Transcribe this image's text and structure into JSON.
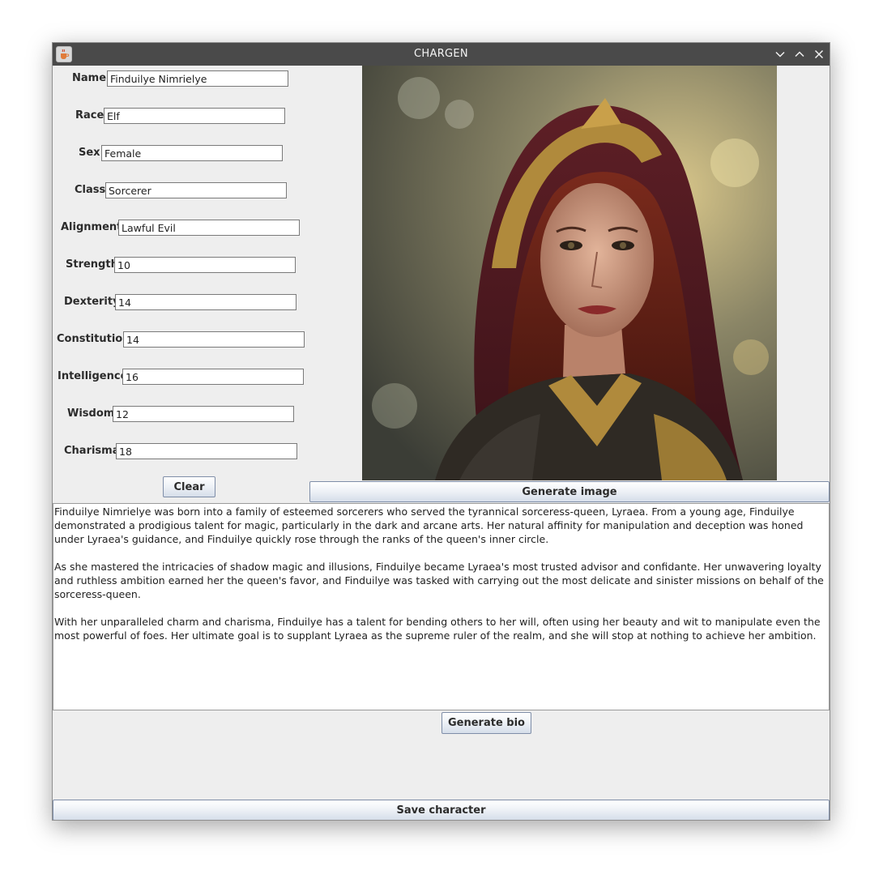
{
  "window": {
    "title": "CHARGEN"
  },
  "icons": {
    "app": "java-cup-icon",
    "minimize": "chevron-down-icon",
    "maximize": "chevron-up-icon",
    "close": "close-icon"
  },
  "fields": {
    "name": {
      "label": "Name:",
      "value": "Finduilye Nimrielye"
    },
    "race": {
      "label": "Race:",
      "value": "Elf"
    },
    "sex": {
      "label": "Sex:",
      "value": "Female"
    },
    "class": {
      "label": "Class:",
      "value": "Sorcerer"
    },
    "alignment": {
      "label": "Alignment:",
      "value": "Lawful Evil"
    },
    "strength": {
      "label": "Strength:",
      "value": "10"
    },
    "dexterity": {
      "label": "Dexterity:",
      "value": "14"
    },
    "constitution": {
      "label": "Constitution:",
      "value": "14"
    },
    "intelligence": {
      "label": "Intelligence:",
      "value": "16"
    },
    "wisdom": {
      "label": "Wisdom:",
      "value": "12"
    },
    "charisma": {
      "label": "Charisma:",
      "value": "18"
    }
  },
  "buttons": {
    "clear": "Clear",
    "generate_image": "Generate image",
    "generate_bio": "Generate bio",
    "save": "Save character"
  },
  "bio": "Finduilye Nimrielye was born into a family of esteemed sorcerers who served the tyrannical sorceress-queen, Lyraea. From a young age, Finduilye demonstrated a prodigious talent for magic, particularly in the dark and arcane arts. Her natural affinity for manipulation and deception was honed under Lyraea's guidance, and Finduilye quickly rose through the ranks of the queen's inner circle.\n\nAs she mastered the intricacies of shadow magic and illusions, Finduilye became Lyraea's most trusted advisor and confidante. Her unwavering loyalty and ruthless ambition earned her the queen's favor, and Finduilye was tasked with carrying out the most delicate and sinister missions on behalf of the sorceress-queen.\n\nWith her unparalleled charm and charisma, Finduilye has a talent for bending others to her will, often using her beauty and wit to manipulate even the most powerful of foes. Her ultimate goal is to supplant Lyraea as the supreme ruler of the realm, and she will stop at nothing to achieve her ambition.",
  "colors": {
    "titlebar": "#4a4a4a",
    "panel": "#eeeeee",
    "button_border": "#7f8ea8"
  }
}
